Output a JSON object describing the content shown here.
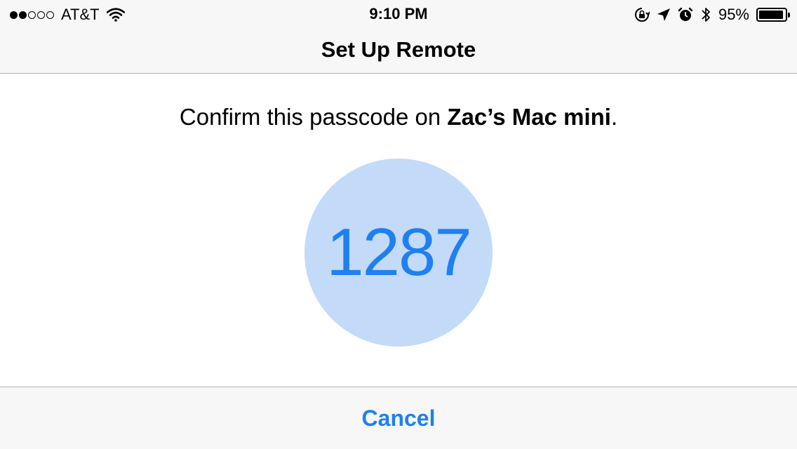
{
  "status_bar": {
    "signal_bars": 2,
    "signal_total": 5,
    "carrier": "AT&T",
    "time": "9:10 PM",
    "icons": [
      "rotation-lock-icon",
      "location-arrow-icon",
      "alarm-icon",
      "bluetooth-icon"
    ],
    "battery_percent": "95%",
    "battery_level": 0.95
  },
  "nav": {
    "title": "Set Up Remote"
  },
  "main": {
    "instruction_prefix": "Confirm this passcode on ",
    "device_name": "Zac’s Mac mini",
    "instruction_suffix": ".",
    "passcode": "1287"
  },
  "footer": {
    "cancel_label": "Cancel"
  },
  "colors": {
    "accent": "#1f80f0",
    "circle": "#c3daf9",
    "bar_background": "#f7f7f7",
    "separator": "#b2b2b2"
  }
}
